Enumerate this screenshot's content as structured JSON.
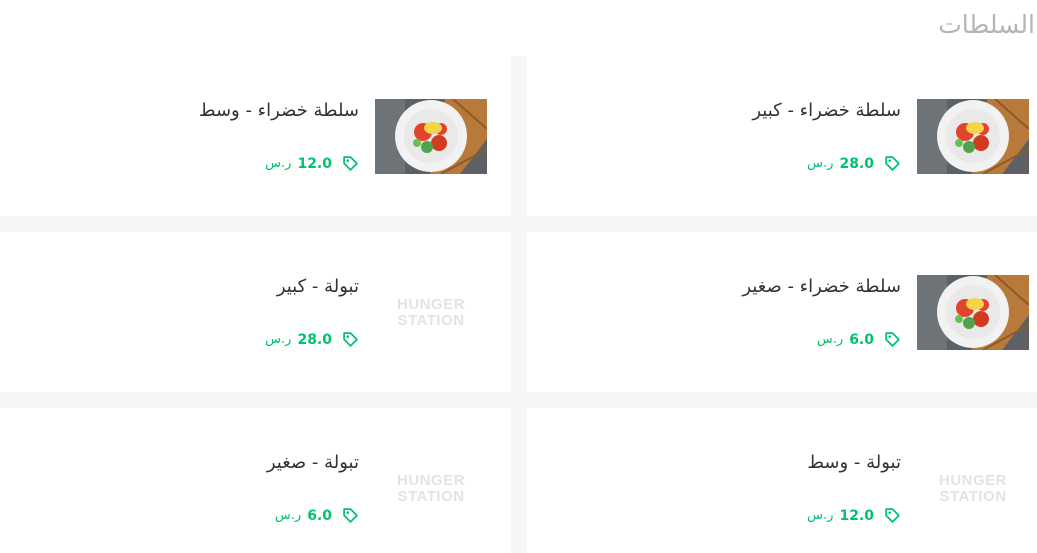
{
  "section": {
    "title": "السلطات"
  },
  "colors": {
    "accent": "#00c26c",
    "title": "#b5b5b5",
    "text": "#333333"
  },
  "items": [
    {
      "name": "سلطة خضراء - كبير",
      "price": "28.0",
      "currency": "ر.س",
      "image": "salad-photo"
    },
    {
      "name": "سلطة خضراء - وسط",
      "price": "12.0",
      "currency": "ر.س",
      "image": "salad-photo"
    },
    {
      "name": "سلطة خضراء - صغير",
      "price": "6.0",
      "currency": "ر.س",
      "image": "salad-photo"
    },
    {
      "name": "تبولة - كبير",
      "price": "28.0",
      "currency": "ر.س",
      "image": "hungerstation-logo",
      "logo_line1": "HUNGER",
      "logo_line2": "STATION"
    },
    {
      "name": "تبولة - وسط",
      "price": "12.0",
      "currency": "ر.س",
      "image": "hungerstation-logo",
      "logo_line1": "HUNGER",
      "logo_line2": "STATION"
    },
    {
      "name": "تبولة - صغير",
      "price": "6.0",
      "currency": "ر.س",
      "image": "hungerstation-logo",
      "logo_line1": "HUNGER",
      "logo_line2": "STATION"
    }
  ]
}
